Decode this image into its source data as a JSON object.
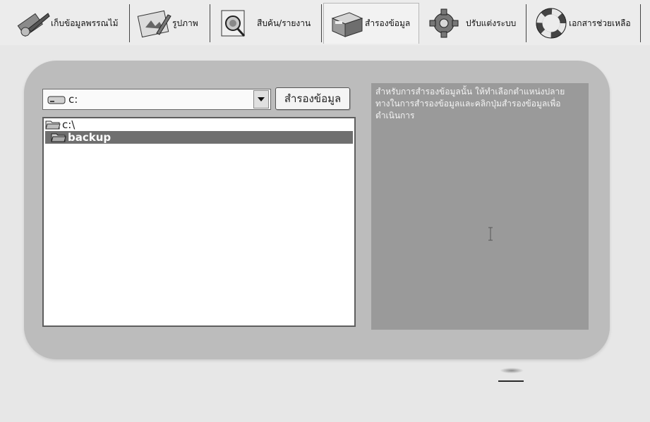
{
  "tabs": [
    {
      "label": "เก็บข้อมูลพรรณไม้",
      "icon": "plant-data-icon"
    },
    {
      "label": "รูปภาพ",
      "icon": "image-icon"
    },
    {
      "label": "สืบค้น/รายงาน",
      "icon": "search-report-icon"
    },
    {
      "label": "สำรองข้อมูล",
      "icon": "file-cabinet-icon"
    },
    {
      "label": "ปรับแต่งระบบ",
      "icon": "gear-icon"
    },
    {
      "label": "เอกสารช่วยเหลือ",
      "icon": "lifebuoy-icon"
    }
  ],
  "active_tab": "สำรองข้อมูล",
  "drive": {
    "selected": "c:",
    "icon": "drive-icon"
  },
  "backup_button": "สำรองข้อมูล",
  "folders": [
    {
      "name": "c:\\",
      "icon": "folder-open-icon",
      "selected": false
    },
    {
      "name": "backup",
      "icon": "folder-open-icon",
      "selected": true
    }
  ],
  "info_text": "สำหรับการสำรองข้อมูลนั้น ให้ทำเลือกตำแหน่งปลายทางในการสำรองข้อมูลและคลิกปุ่มสำรองข้อมูลเพื่อดำเนินการ"
}
